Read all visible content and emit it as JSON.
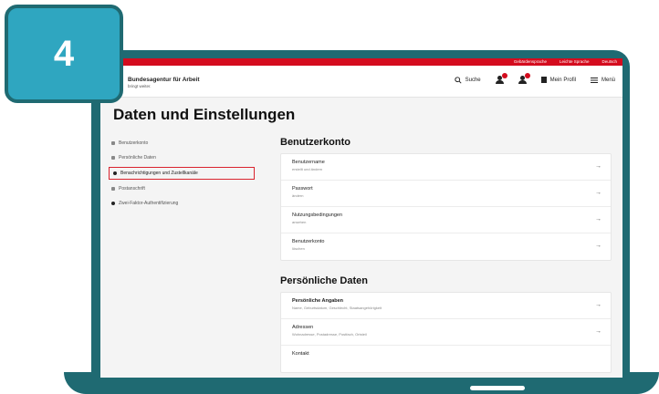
{
  "step": "4",
  "topbar": {
    "links": [
      "Gebärdensprache",
      "Leichte Sprache",
      "Deutsch"
    ]
  },
  "brand": {
    "name": "Bundesagentur für Arbeit",
    "sub": "bringt weiter."
  },
  "header_nav": {
    "search_label": "Suche",
    "profile_label": "Mein Profil",
    "menu_label": "Menü"
  },
  "page_title": "Daten und Einstellungen",
  "sidebar": {
    "items": [
      {
        "label": "Benutzerkonto"
      },
      {
        "label": "Persönliche Daten"
      },
      {
        "label": "Benachrichtigungen und Zustellkanäle"
      },
      {
        "label": "Postanschrift"
      },
      {
        "label": "Zwei-Faktor-Authentifizierung"
      }
    ]
  },
  "sections": [
    {
      "title": "Benutzerkonto",
      "rows": [
        {
          "title": "Benutzername",
          "sub": "erstellt und ändern"
        },
        {
          "title": "Passwort",
          "sub": "ändern"
        },
        {
          "title": "Nutzungsbedingungen",
          "sub": "ansehen"
        },
        {
          "title": "Benutzerkonto",
          "sub": "löschen"
        }
      ]
    },
    {
      "title": "Persönliche Daten",
      "rows": [
        {
          "title": "Persönliche Angaben",
          "sub": "Name, Geburtsdatum, Geschlecht, Staatsangehörigkeit"
        },
        {
          "title": "Adressen",
          "sub": "Wohnadresse, Postadresse, Postfach, Ortsteil"
        },
        {
          "title": "Kontakt",
          "sub": ""
        }
      ]
    }
  ]
}
